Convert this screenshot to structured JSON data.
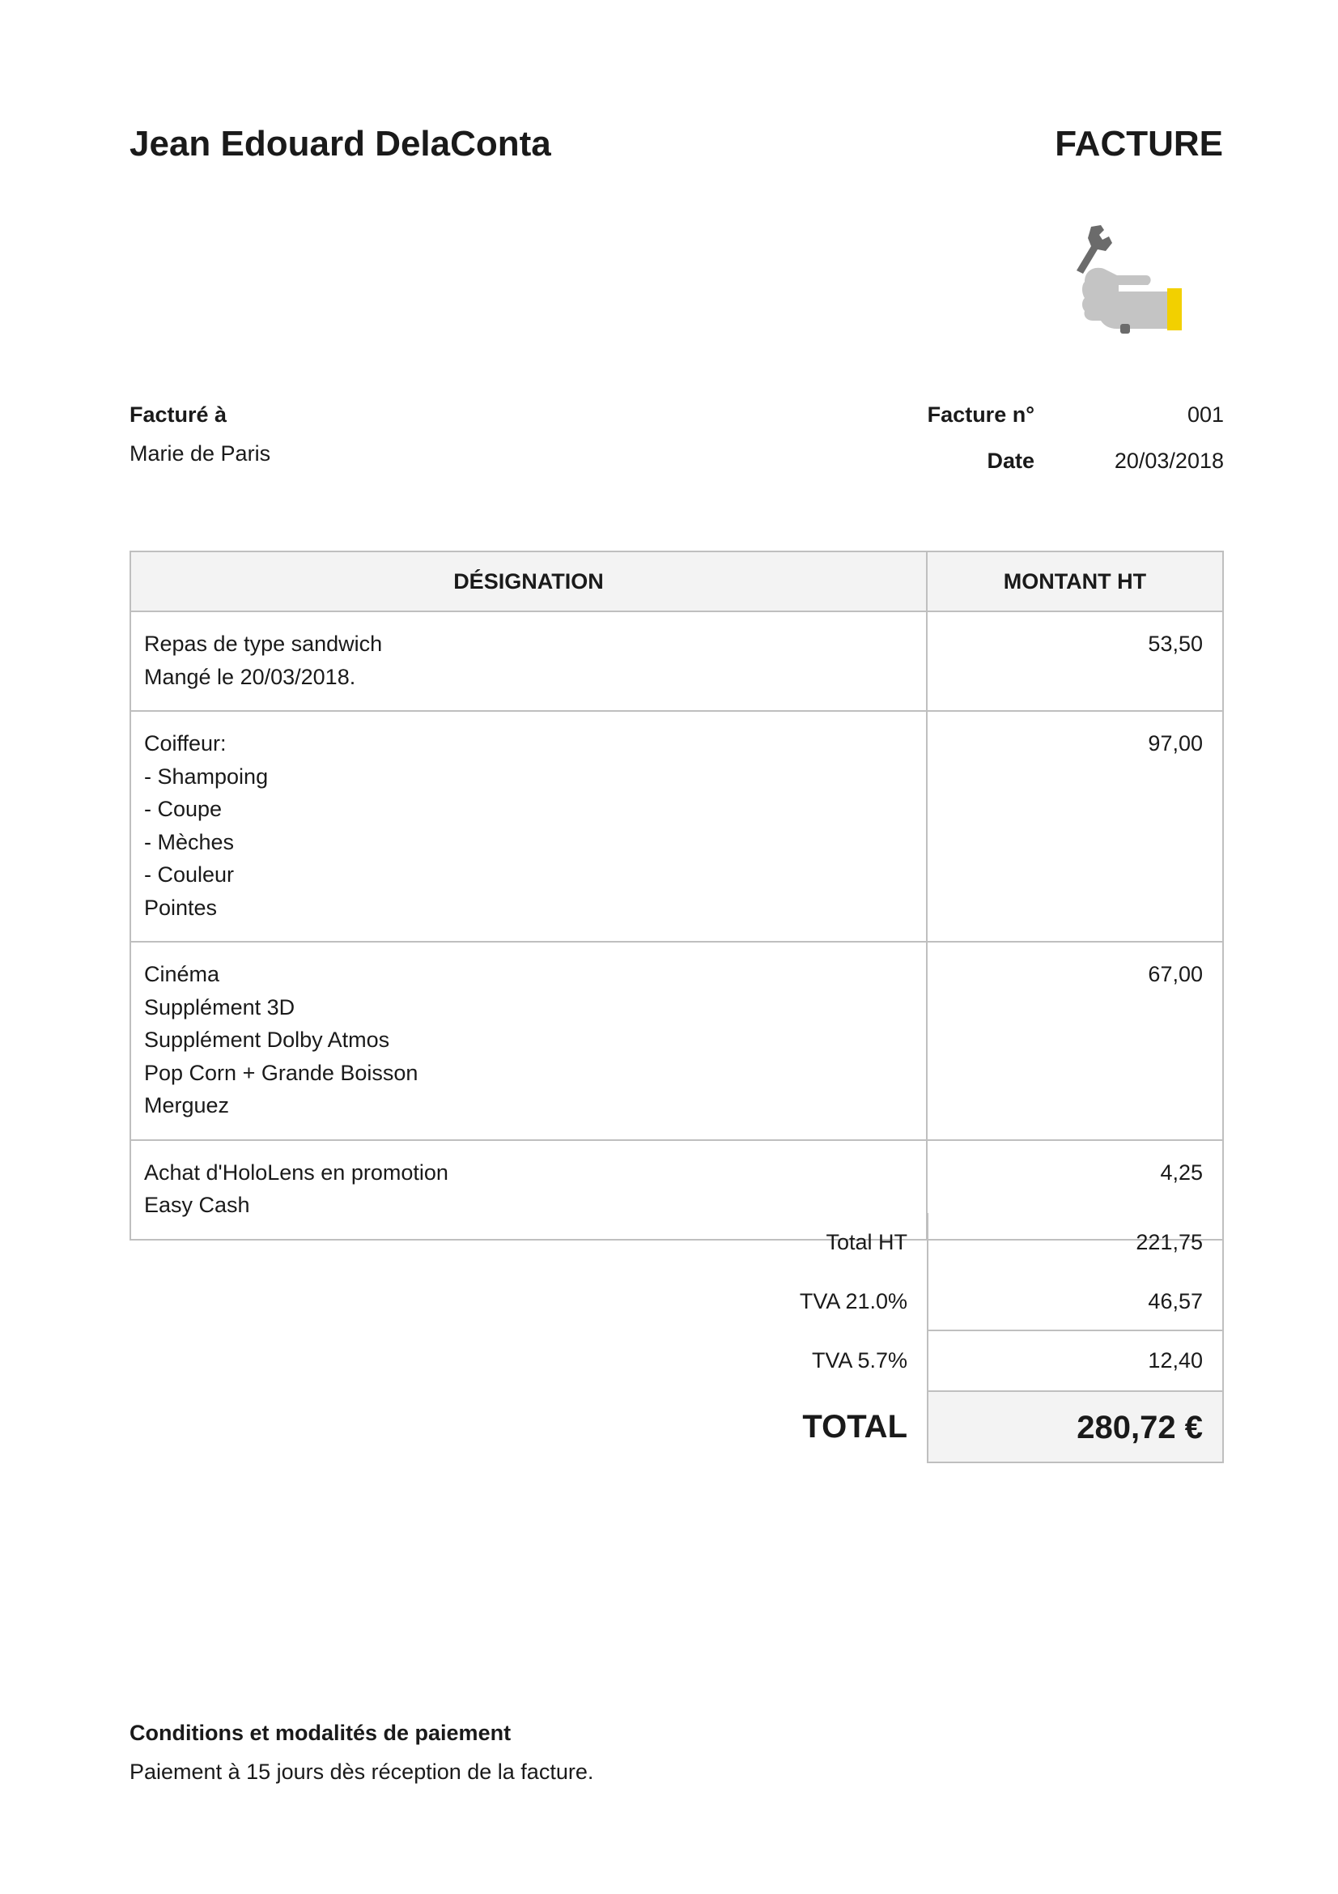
{
  "header": {
    "sender_name": "Jean Edouard DelaConta",
    "doc_title": "FACTURE",
    "logo_icon": "wrench-hand-icon"
  },
  "billing": {
    "billed_to_label": "Facturé à",
    "billed_to_name": "Marie de Paris",
    "invoice_number_label": "Facture n°",
    "invoice_number": "001",
    "date_label": "Date",
    "date": "20/03/2018"
  },
  "items_table": {
    "headers": {
      "designation": "DÉSIGNATION",
      "amount": "MONTANT HT"
    },
    "rows": [
      {
        "lines": [
          "Repas de type sandwich",
          "Mangé le 20/03/2018."
        ],
        "amount": "53,50"
      },
      {
        "lines": [
          "Coiffeur:",
          "- Shampoing",
          "- Coupe",
          "- Mèches",
          "- Couleur",
          "Pointes"
        ],
        "amount": "97,00"
      },
      {
        "lines": [
          "Cinéma",
          "Supplément 3D",
          "Supplément Dolby Atmos",
          "Pop Corn + Grande Boisson",
          "Merguez"
        ],
        "amount": "67,00"
      },
      {
        "lines": [
          "Achat d'HoloLens en promotion",
          "Easy Cash"
        ],
        "amount": "4,25"
      }
    ]
  },
  "totals": {
    "total_ht_label": "Total HT",
    "total_ht": "221,75",
    "tva1_label": "TVA 21.0%",
    "tva1": "46,57",
    "tva2_label": "TVA 5.7%",
    "tva2": "12,40",
    "grand_total_label": "TOTAL",
    "grand_total": "280,72 €"
  },
  "terms": {
    "title": "Conditions et modalités de paiement",
    "text": "Paiement à 15 jours dès réception de la facture."
  },
  "colors": {
    "header_fill": "#f3f3f3",
    "border": "#bfbfbf",
    "logo_accent": "#f2d000",
    "logo_grey": "#6b6b6b"
  }
}
